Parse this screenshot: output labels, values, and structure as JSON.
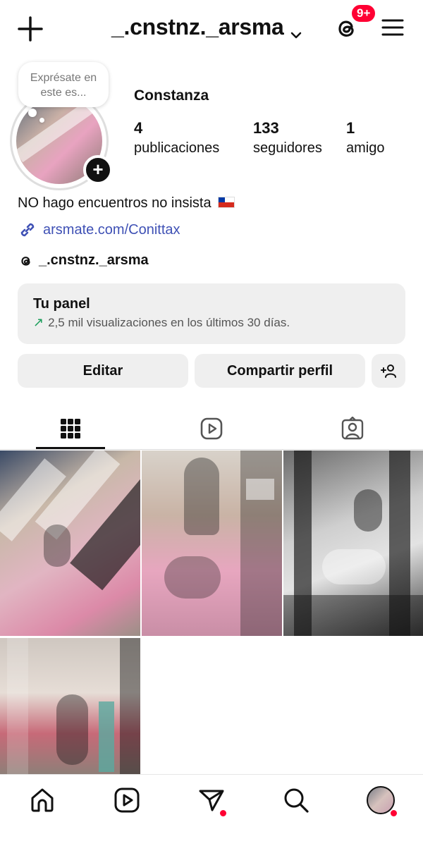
{
  "header": {
    "username": "_.cnstnz._arsma",
    "notification_badge": "9+"
  },
  "profile": {
    "note_placeholder": "Exprésate en este es...",
    "display_name": "Constanza",
    "stats": [
      {
        "value": "4",
        "label": "publicaciones"
      },
      {
        "value": "133",
        "label": "seguidores"
      },
      {
        "value": "1",
        "label": "amigo"
      }
    ],
    "bio": "NO hago encuentros no insista",
    "link": "arsmate.com/Conittax",
    "threads_handle": "_.cnstnz._arsma"
  },
  "panel": {
    "title": "Tu panel",
    "subtitle": "2,5 mil visualizaciones en los últimos 30 días."
  },
  "actions": {
    "edit": "Editar",
    "share": "Compartir perfil"
  },
  "tabs": [
    "grid-icon",
    "reels-icon",
    "tagged-icon"
  ],
  "grid": {
    "posts": [
      "photo-1",
      "photo-2",
      "photo-3",
      "photo-4"
    ]
  },
  "bottom_nav": [
    "home-icon",
    "reels-icon",
    "direct-messages-icon",
    "search-icon",
    "profile-avatar"
  ],
  "colors": {
    "accent_red": "#ff0033",
    "link_blue": "#3f51b5",
    "trend_green": "#1a9d5a",
    "button_gray": "#efefef"
  }
}
